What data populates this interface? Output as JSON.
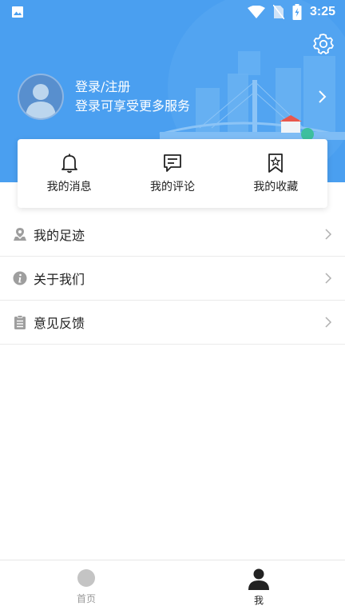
{
  "status_bar": {
    "time": "3:25"
  },
  "profile": {
    "title": "登录/注册",
    "subtitle": "登录可享受更多服务"
  },
  "quick_actions": [
    {
      "label": "我的消息",
      "icon": "bell-icon"
    },
    {
      "label": "我的评论",
      "icon": "comment-icon"
    },
    {
      "label": "我的收藏",
      "icon": "bookmark-star-icon"
    }
  ],
  "menu": [
    {
      "label": "我的足迹",
      "icon": "location-pin-icon"
    },
    {
      "label": "关于我们",
      "icon": "info-icon"
    },
    {
      "label": "意见反馈",
      "icon": "clipboard-icon"
    }
  ],
  "tabs": [
    {
      "label": "首页",
      "active": false
    },
    {
      "label": "我",
      "active": true
    }
  ],
  "colors": {
    "header_blue": "#4a9ff0",
    "icon_gray": "#9e9e9e",
    "active_tab": "#222222"
  }
}
